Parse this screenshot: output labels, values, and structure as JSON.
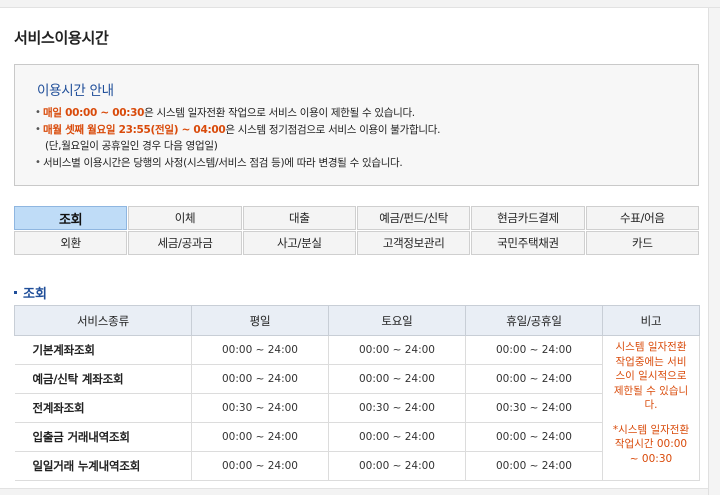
{
  "page": {
    "title": "서비스이용시간"
  },
  "notice": {
    "title": "이용시간 안내",
    "line1_highlight": "매일 00:00 ~ 00:30",
    "line1_text": "은 시스템 일자전환 작업으로 서비스 이용이 제한될 수 있습니다.",
    "line2_highlight": "매월 셋째 월요일 23:55(전일) ~ 04:00",
    "line2_text": "은 시스템 정기점검으로 서비스 이용이 불가합니다.",
    "line2_sub": "(단,월요일이 공휴일인 경우 다음 영업일)",
    "line3_text": "서비스별 이용시간은 당행의 사정(시스템/서비스 점검 등)에 따라 변경될 수 있습니다.",
    "accent_color": "#d94b0b"
  },
  "tabs": [
    {
      "label": "조회",
      "active": true
    },
    {
      "label": "이체",
      "active": false
    },
    {
      "label": "대출",
      "active": false
    },
    {
      "label": "예금/펀드/신탁",
      "active": false
    },
    {
      "label": "현금카드결제",
      "active": false
    },
    {
      "label": "수표/어음",
      "active": false
    },
    {
      "label": "외환",
      "active": false
    },
    {
      "label": "세금/공과금",
      "active": false
    },
    {
      "label": "사고/분실",
      "active": false
    },
    {
      "label": "고객정보관리",
      "active": false
    },
    {
      "label": "국민주택채권",
      "active": false
    },
    {
      "label": "카드",
      "active": false
    }
  ],
  "section": {
    "title": "조회"
  },
  "table": {
    "headers": [
      "서비스종류",
      "평일",
      "토요일",
      "휴일/공휴일",
      "비고"
    ],
    "rows": [
      {
        "name": "기본계좌조회",
        "weekday": "00:00 ~ 24:00",
        "saturday": "00:00 ~ 24:00",
        "holiday": "00:00 ~ 24:00"
      },
      {
        "name": "예금/신탁 계좌조회",
        "weekday": "00:00 ~ 24:00",
        "saturday": "00:00 ~ 24:00",
        "holiday": "00:00 ~ 24:00"
      },
      {
        "name": "전계좌조회",
        "weekday": "00:30 ~ 24:00",
        "saturday": "00:30 ~ 24:00",
        "holiday": "00:30 ~ 24:00"
      },
      {
        "name": "입출금 거래내역조회",
        "weekday": "00:00 ~ 24:00",
        "saturday": "00:00 ~ 24:00",
        "holiday": "00:00 ~ 24:00"
      },
      {
        "name": "일일거래 누계내역조회",
        "weekday": "00:00 ~ 24:00",
        "saturday": "00:00 ~ 24:00",
        "holiday": "00:00 ~ 24:00"
      }
    ],
    "note_part1": "시스템 일자전환 작업중에는 서비스이 일시적으로 제한될 수 있습니다.",
    "note_part2": "*시스템 일자전환 작업시간 00:00 ~ 00:30"
  }
}
